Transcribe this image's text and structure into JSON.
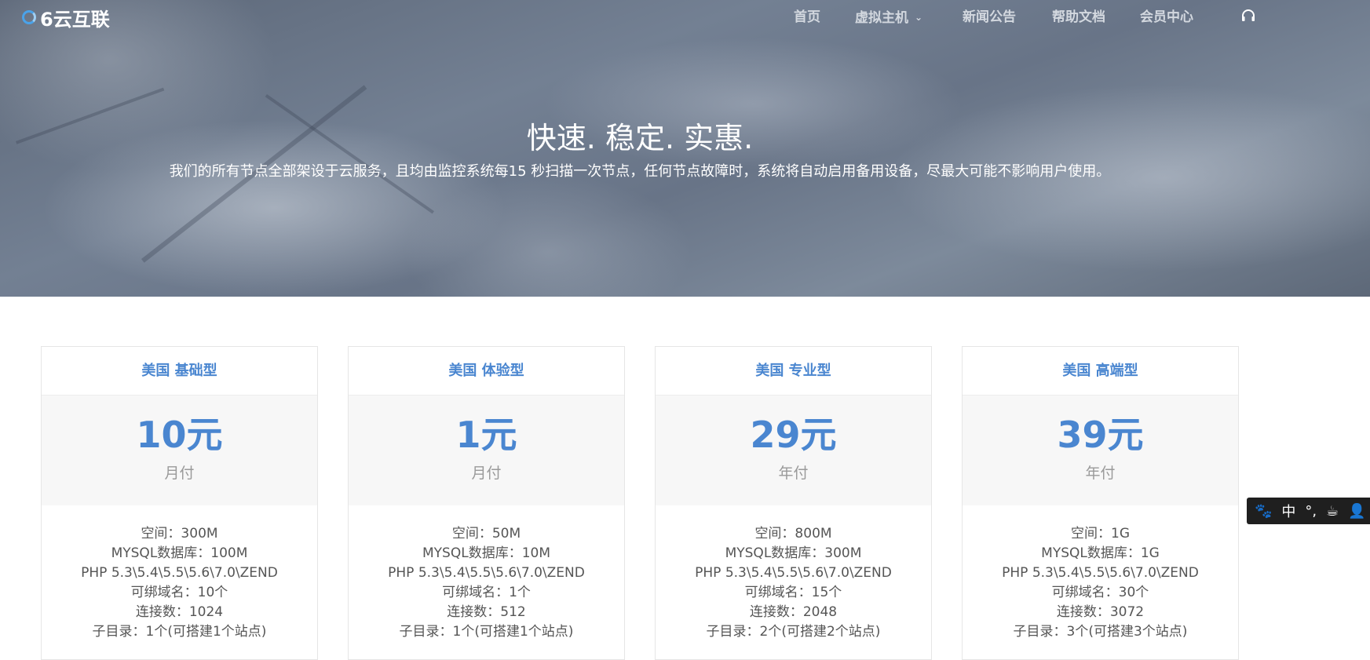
{
  "logo": {
    "text": "6云互联"
  },
  "nav": {
    "items": [
      {
        "label": "首页"
      },
      {
        "label": "虚拟主机",
        "has_dropdown": true
      },
      {
        "label": "新闻公告"
      },
      {
        "label": "帮助文档"
      },
      {
        "label": "会员中心"
      }
    ],
    "support_icon": "headset-icon"
  },
  "hero": {
    "title": "快速. 稳定. 实惠.",
    "subtitle": "我们的所有节点全部架设于云服务，且均由监控系统每15 秒扫描一次节点，任何节点故障时，系统将自动启用备用设备，尽最大可能不影响用户使用。"
  },
  "plans": [
    {
      "name": "美国 基础型",
      "price": "10元",
      "period": "月付",
      "features": [
        "空间：300M",
        "MYSQL数据库：100M",
        "PHP 5.3\\5.4\\5.5\\5.6\\7.0\\ZEND",
        "可绑域名：10个",
        "连接数：1024",
        "子目录：1个(可搭建1个站点)"
      ]
    },
    {
      "name": "美国 体验型",
      "price": "1元",
      "period": "月付",
      "features": [
        "空间：50M",
        "MYSQL数据库：10M",
        "PHP 5.3\\5.4\\5.5\\5.6\\7.0\\ZEND",
        "可绑域名：1个",
        "连接数：512",
        "子目录：1个(可搭建1个站点)"
      ]
    },
    {
      "name": "美国 专业型",
      "price": "29元",
      "period": "年付",
      "features": [
        "空间：800M",
        "MYSQL数据库：300M",
        "PHP 5.3\\5.4\\5.5\\5.6\\7.0\\ZEND",
        "可绑域名：15个",
        "连接数：2048",
        "子目录：2个(可搭建2个站点)"
      ]
    },
    {
      "name": "美国 高端型",
      "price": "39元",
      "period": "年付",
      "features": [
        "空间：1G",
        "MYSQL数据库：1G",
        "PHP 5.3\\5.4\\5.5\\5.6\\7.0\\ZEND",
        "可绑域名：30个",
        "连接数：3072",
        "子目录：3个(可搭建3个站点)"
      ]
    }
  ],
  "ime_toolbar": {
    "items": [
      {
        "icon": "paw-icon",
        "glyph": "🐾"
      },
      {
        "icon": "chinese-mode-icon",
        "glyph": "中"
      },
      {
        "icon": "punctuation-icon",
        "glyph": "°,"
      },
      {
        "icon": "cup-icon",
        "glyph": "☕"
      },
      {
        "icon": "user-icon",
        "glyph": "👤"
      }
    ]
  },
  "colors": {
    "accent": "#4a86d0",
    "logo_ring": "#4aa3ea",
    "card_price_bg": "#f7f7f7"
  }
}
